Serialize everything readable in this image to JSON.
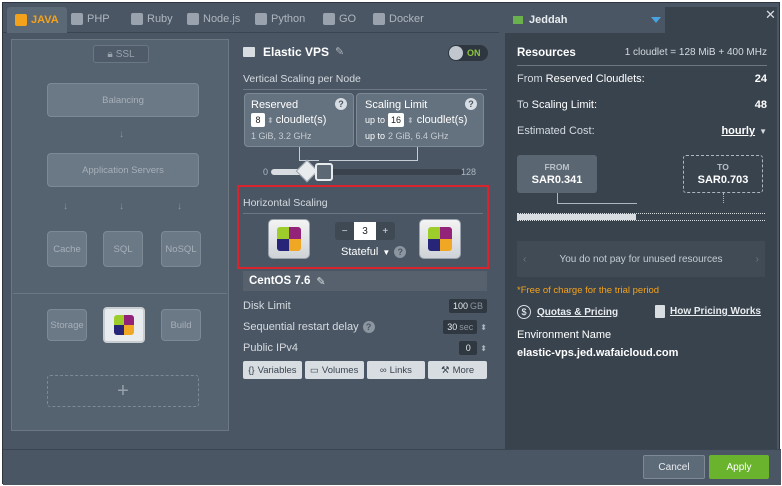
{
  "tabs": [
    {
      "label": "JAVA",
      "icon": "java-icon",
      "active": true
    },
    {
      "label": "PHP",
      "icon": "php-icon"
    },
    {
      "label": "Ruby",
      "icon": "ruby-icon"
    },
    {
      "label": "Node.js",
      "icon": "nodejs-icon"
    },
    {
      "label": "Python",
      "icon": "python-icon"
    },
    {
      "label": "GO",
      "icon": "go-icon"
    },
    {
      "label": "Docker",
      "icon": "docker-icon"
    }
  ],
  "topology": {
    "ssl": "SSL",
    "balancing": "Balancing",
    "app_servers": "Application Servers",
    "cache": "Cache",
    "sql": "SQL",
    "nosql": "NoSQL",
    "storage": "Storage",
    "build": "Build",
    "add": "+"
  },
  "node": {
    "title": "Elastic VPS",
    "toggle": "ON",
    "vertical_label": "Vertical Scaling per Node",
    "reserved": {
      "title": "Reserved",
      "value": "8",
      "unit": "cloudlet(s)",
      "spec": "1 GiB, 3.2 GHz"
    },
    "limit": {
      "title": "Scaling Limit",
      "prefix": "up to",
      "value": "16",
      "unit": "cloudlet(s)",
      "spec_prefix": "up to",
      "spec": "2 GiB, 6.4 GHz"
    },
    "slider_min": "0",
    "slider_max": "128",
    "horizontal_label": "Horizontal Scaling",
    "count": "3",
    "minus": "−",
    "plus": "+",
    "mode": "Stateful",
    "os": "CentOS 7.6",
    "disk_label": "Disk Limit",
    "disk_value": "100",
    "disk_unit": "GB",
    "restart_label": "Sequential restart delay",
    "restart_value": "30",
    "restart_unit": "sec",
    "ipv4_label": "Public IPv4",
    "ipv4_value": "0",
    "buttons": [
      "Variables",
      "Volumes",
      "Links",
      "More"
    ]
  },
  "region": {
    "name": "Jeddah",
    "resources_label": "Resources",
    "cloudlet_def": "1 cloudlet = 128 MiB + 400 MHz",
    "from_label_prefix": "From",
    "from_label": "Reserved Cloudlets:",
    "from_value": "24",
    "to_label_prefix": "To",
    "to_label": "Scaling Limit:",
    "to_value": "48",
    "cost_label": "Estimated Cost:",
    "cost_period": "hourly",
    "price_from_label": "FROM",
    "price_from": "SAR0.341",
    "price_to_label": "TO",
    "price_to": "SAR0.703",
    "price_fill": 0.48,
    "unused_note": "You do not pay for unused resources",
    "free_note": "*Free of charge for the trial period",
    "quotas_link": "Quotas & Pricing",
    "pricing_link": "How Pricing Works",
    "env_label": "Environment Name",
    "env_value": "elastic-vps.jed.wafaicloud.com"
  },
  "footer": {
    "cancel": "Cancel",
    "apply": "Apply"
  },
  "colors": {
    "accent": "#f4a21c",
    "apply": "#6ab42d",
    "highlight": "#d9232d",
    "on": "#8ec63f"
  }
}
